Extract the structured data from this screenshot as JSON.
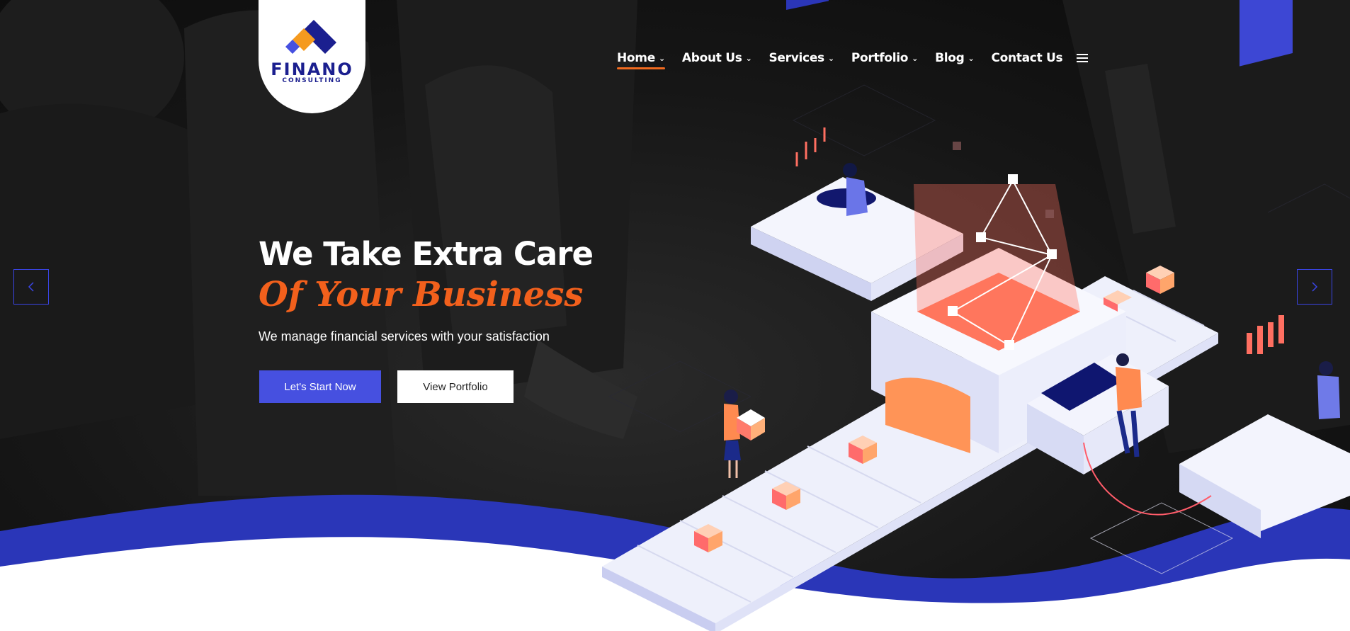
{
  "brand": {
    "name": "FINANO",
    "tagline": "CONSULTING",
    "colors": {
      "navy": "#1b1f8f",
      "blue": "#4650e0",
      "orange": "#f2601c"
    }
  },
  "nav": {
    "items": [
      {
        "label": "Home",
        "has_dropdown": true,
        "active": true
      },
      {
        "label": "About Us",
        "has_dropdown": true,
        "active": false
      },
      {
        "label": "Services",
        "has_dropdown": true,
        "active": false
      },
      {
        "label": "Portfolio",
        "has_dropdown": true,
        "active": false
      },
      {
        "label": "Blog",
        "has_dropdown": true,
        "active": false
      },
      {
        "label": "Contact Us",
        "has_dropdown": false,
        "active": false
      }
    ],
    "menu_icon": "hamburger-icon"
  },
  "hero": {
    "heading": "We Take Extra Care",
    "heading_accent": "Of Your Business",
    "subtext": "We manage financial services with your satisfaction",
    "primary_button": "Let's Start Now",
    "secondary_button": "View Portfolio"
  },
  "slider": {
    "prev_icon": "chevron-left-icon",
    "next_icon": "chevron-right-icon"
  }
}
